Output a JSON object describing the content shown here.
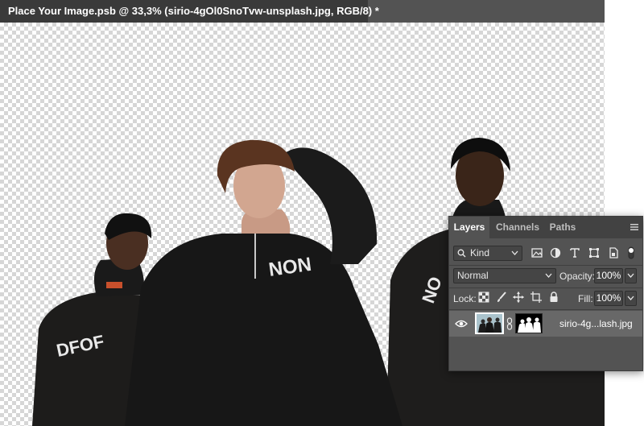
{
  "document": {
    "tab_title": "Place Your Image.psb @ 33,3% (sirio-4gOl0SnoTvw-unsplash.jpg, RGB/8) *"
  },
  "layers_panel": {
    "tabs": [
      {
        "label": "Layers",
        "active": true
      },
      {
        "label": "Channels",
        "active": false
      },
      {
        "label": "Paths",
        "active": false
      }
    ],
    "filter": {
      "label": "Kind"
    },
    "blend_mode": "Normal",
    "opacity_label": "Opacity:",
    "opacity_value": "100%",
    "lock_label": "Lock:",
    "fill_label": "Fill:",
    "fill_value": "100%",
    "layers": [
      {
        "name": "sirio-4g...lash.jpg",
        "visible": true,
        "has_mask": true,
        "selected": true
      }
    ]
  },
  "colors": {
    "panel_bg": "#535353",
    "tab_bg": "#424242",
    "selected_row": "#686868",
    "doc_tab_bg": "#3a3a3a"
  }
}
